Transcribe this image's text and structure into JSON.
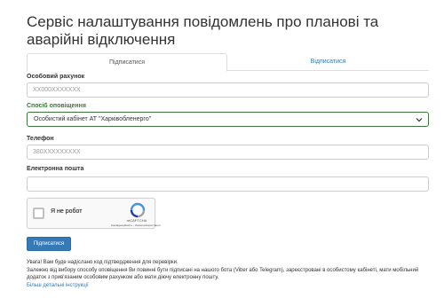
{
  "page": {
    "title": "Сервіс налаштування повідомлень про планові та аварійні відключення"
  },
  "tabs": [
    {
      "label": "Підписатися",
      "active": true
    },
    {
      "label": "Відписатися",
      "active": false
    }
  ],
  "form": {
    "account": {
      "label": "Особовий рахунок",
      "placeholder": "XX000XXXXXXX"
    },
    "notify_method": {
      "label": "Спосіб оповіщення",
      "selected": "Особистий кабінет АТ \"Харківобленерго\""
    },
    "phone": {
      "label": "Телефон",
      "placeholder": "380XXXXXXXXX"
    },
    "email": {
      "label": "Електронна пошта",
      "placeholder": ""
    },
    "captcha": {
      "label": "Я не робот",
      "brand": "reCAPTCHA",
      "terms": "Конфіденційність - Умови використання"
    },
    "submit_label": "Підписатися"
  },
  "note": {
    "warning": "Увага! Вам буде надіслано код підтвердження для перевірки.",
    "details": "Залежно від вибору способу оповіщення Ви повинні бути підписані на нашого бота (Viber або Telegram), зареєстровані в особистому кабінеті, мати мобільний додаток з прив'язаним особовим рахунком або мати діючу електронну пошту.",
    "link": "Більш детальні інструкції"
  },
  "colors": {
    "primary": "#337ab7",
    "success": "#3c763d",
    "border": "#cccccc"
  }
}
